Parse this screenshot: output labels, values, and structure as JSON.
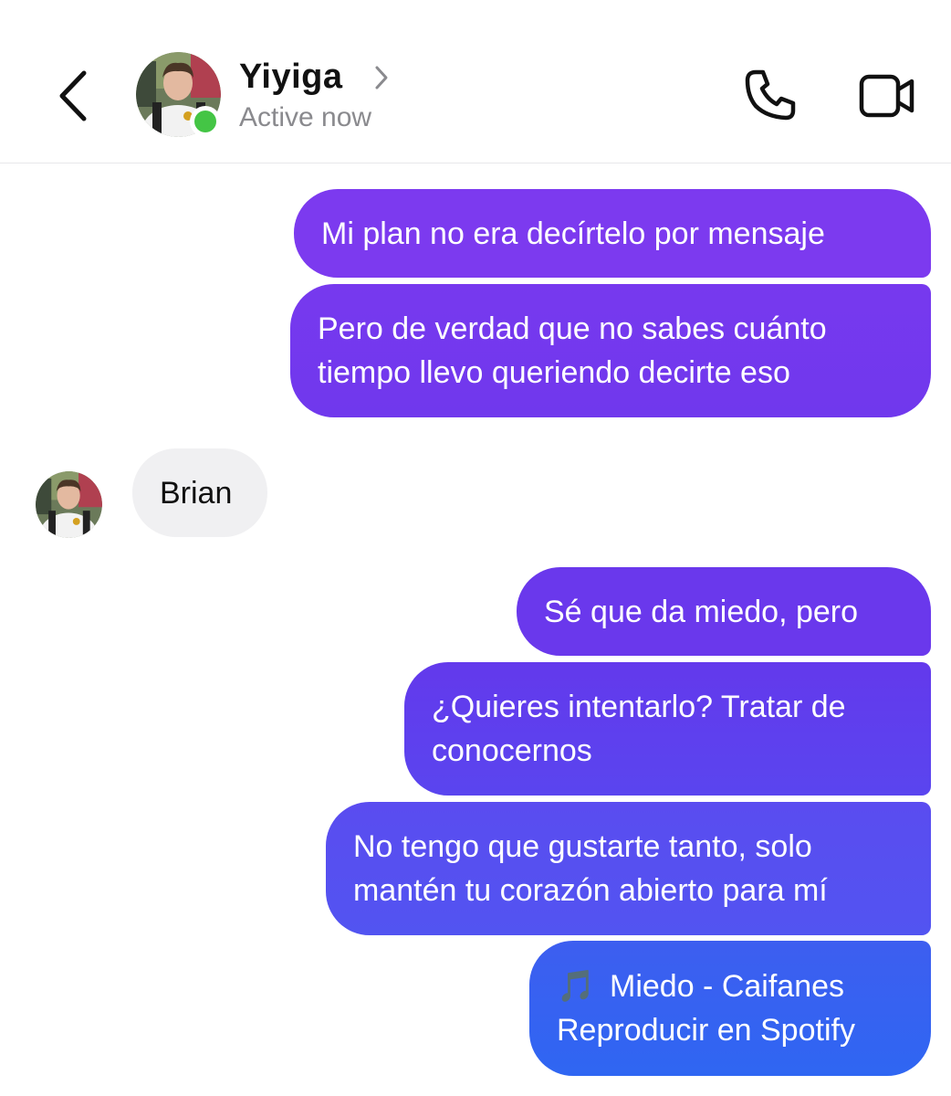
{
  "header": {
    "contact_name": "Yiyiga",
    "status": "Active now",
    "online_color": "#44c545",
    "icons": {
      "back": "chevron-left-icon",
      "name_chevron": "chevron-right-icon",
      "call": "phone-icon",
      "video": "video-camera-icon"
    }
  },
  "messages": [
    {
      "sender": "me",
      "lines": [
        "Mi plan no era decírtelo por mensaje"
      ]
    },
    {
      "sender": "me",
      "lines": [
        "Pero de verdad que no sabes cuánto",
        "tiempo llevo queriendo decirte eso"
      ]
    },
    {
      "sender": "them",
      "lines": [
        "Brian"
      ]
    },
    {
      "sender": "me",
      "lines": [
        "Sé que da miedo, pero"
      ]
    },
    {
      "sender": "me",
      "lines": [
        "¿Quieres intentarlo? Tratar de",
        "conocernos"
      ]
    },
    {
      "sender": "me",
      "lines": [
        "No tengo que gustarte tanto, solo",
        "mantén tu corazón abierto para mí"
      ]
    },
    {
      "sender": "me",
      "icon": "🎵",
      "lines": [
        "Miedo - Caifanes",
        "Reproducir en Spotify"
      ]
    }
  ],
  "colors": {
    "sent_top": "#7c3aef",
    "sent_bottom": "#2f66f2",
    "received": "#f0f0f2"
  }
}
